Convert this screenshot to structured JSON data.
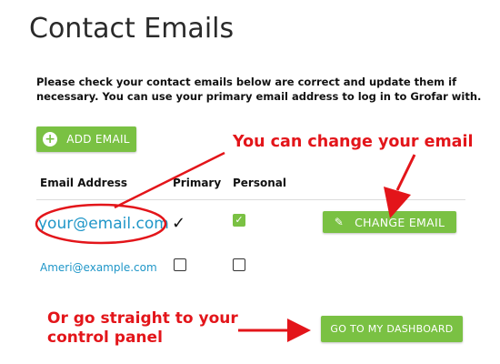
{
  "page": {
    "title": "Contact Emails",
    "intro": "Please check your contact emails below are correct and update them if necessary. You can use your primary email address to log in to Grofar with."
  },
  "actions": {
    "add_email_label": "ADD EMAIL",
    "change_email_label": "CHANGE EMAIL",
    "dashboard_label": "GO TO MY DASHBOARD"
  },
  "table": {
    "headers": {
      "email": "Email Address",
      "primary": "Primary",
      "personal": "Personal"
    },
    "rows": [
      {
        "email": "your@email.com",
        "primary": true,
        "personal": true
      },
      {
        "email": "Ameri@example.com",
        "primary": false,
        "personal": false
      }
    ]
  },
  "annotations": {
    "change_hint": "You can change your email",
    "dashboard_hint_line1": "Or go straight to your",
    "dashboard_hint_line2": "control panel"
  },
  "colors": {
    "accent_green": "#7ac143",
    "link_blue": "#1f96c8",
    "annotation_red": "#e3151a"
  },
  "icons": {
    "add": "plus-circle-icon",
    "edit": "pencil-icon",
    "check": "checkmark-icon"
  }
}
